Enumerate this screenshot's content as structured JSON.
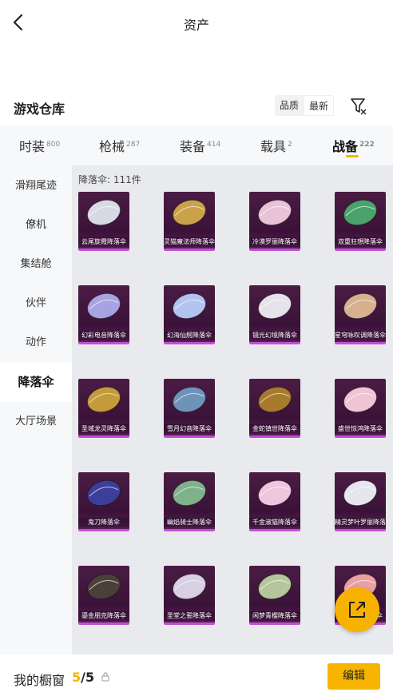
{
  "header": {
    "title": "资产"
  },
  "section": {
    "title": "游戏仓库"
  },
  "sort": {
    "options": [
      "品质",
      "最新"
    ],
    "active": 1
  },
  "tabs": [
    {
      "label": "时装",
      "count": "800"
    },
    {
      "label": "枪械",
      "count": "287"
    },
    {
      "label": "装备",
      "count": "414"
    },
    {
      "label": "载具",
      "count": "2"
    },
    {
      "label": "战备",
      "count": "222"
    }
  ],
  "active_tab": 4,
  "sidebar": {
    "items": [
      "滑翔尾迹",
      "僚机",
      "集结舱",
      "伙伴",
      "动作",
      "降落伞",
      "大厅场景"
    ],
    "active": 5
  },
  "grid": {
    "count_label": "降落伞: 111件",
    "items": [
      {
        "name": "云尾旋霞降落伞",
        "color": "#d9d9e6"
      },
      {
        "name": "灵猫魔法师降落伞",
        "color": "#c9a24a"
      },
      {
        "name": "冷漠罗丽降落伞",
        "color": "#e8c3d6"
      },
      {
        "name": "双重狂想降落伞",
        "color": "#4aa36b"
      },
      {
        "name": "幻彩电音降落伞",
        "color": "#a7a2e0"
      },
      {
        "name": "幻海仙舸降落伞",
        "color": "#b3c3f0"
      },
      {
        "name": "镜光幻境降落伞",
        "color": "#e6e2ea"
      },
      {
        "name": "星穹咏叹调降落伞",
        "color": "#d7b08f"
      },
      {
        "name": "圣域龙灵降落伞",
        "color": "#c49a3a"
      },
      {
        "name": "雪月幻音降落伞",
        "color": "#6f93b8"
      },
      {
        "name": "金蛇镇世降落伞",
        "color": "#a77a2e"
      },
      {
        "name": "盛世惊鸿降落伞",
        "color": "#f0c4d4"
      },
      {
        "name": "鬼刀降落伞",
        "color": "#3b3f9a"
      },
      {
        "name": "幽焰骑士降落伞",
        "color": "#7fb18a"
      },
      {
        "name": "千金淑猫降落伞",
        "color": "#f0c6dc"
      },
      {
        "name": "精灵梦叶罗丽降落伞",
        "color": "#e6e6f0"
      },
      {
        "name": "鎏金朋克降落伞",
        "color": "#4a4038"
      },
      {
        "name": "圣堂之誓降落伞",
        "color": "#d8cfe3"
      },
      {
        "name": "闲梦青樱降落伞",
        "color": "#b5c79a"
      },
      {
        "name": "缤纷甜心降落伞",
        "color": "#e8a0a0"
      }
    ]
  },
  "bottom": {
    "label": "我的橱窗",
    "current": "5",
    "separator": "/",
    "total": "5",
    "edit_label": "编辑"
  },
  "colors": {
    "accent": "#f5b400",
    "item_frame": "#c34ed6"
  }
}
